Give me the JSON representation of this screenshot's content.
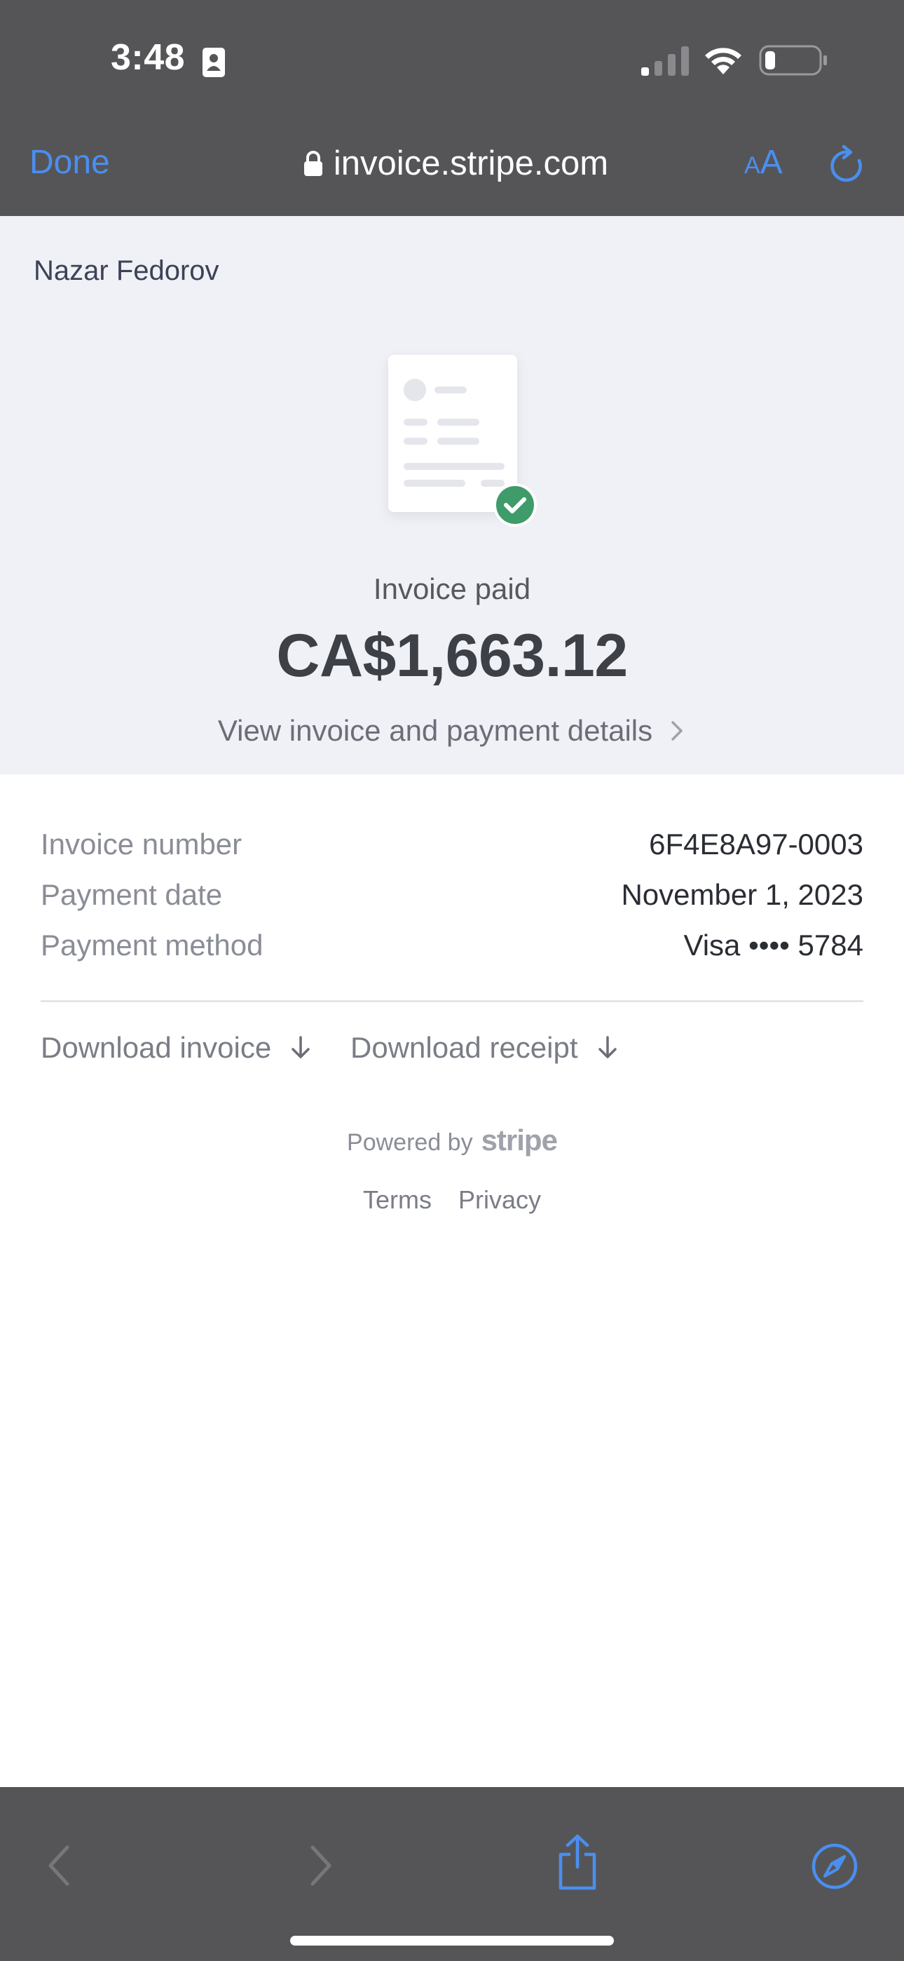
{
  "status_bar": {
    "time": "3:48"
  },
  "browser": {
    "done_label": "Done",
    "url": "invoice.stripe.com",
    "text_size_small": "A",
    "text_size_large": "A",
    "accent_color": "#4a8ff0"
  },
  "invoice": {
    "merchant_name": "Nazar Fedorov",
    "status_label": "Invoice paid",
    "amount": "CA$1,663.12",
    "view_details_label": "View invoice and payment details",
    "success_color": "#3f9c6a",
    "details": [
      {
        "key": "Invoice number",
        "value": "6F4E8A97-0003"
      },
      {
        "key": "Payment date",
        "value": "November 1, 2023"
      },
      {
        "key": "Payment method",
        "value": "Visa •••• 5784"
      }
    ],
    "download_invoice_label": "Download invoice",
    "download_receipt_label": "Download receipt"
  },
  "footer": {
    "powered_by": "Powered by",
    "brand": "stripe",
    "terms_label": "Terms",
    "privacy_label": "Privacy"
  },
  "toolbar": {
    "icons": [
      "back-icon",
      "forward-icon",
      "share-icon",
      "compass-icon"
    ]
  }
}
